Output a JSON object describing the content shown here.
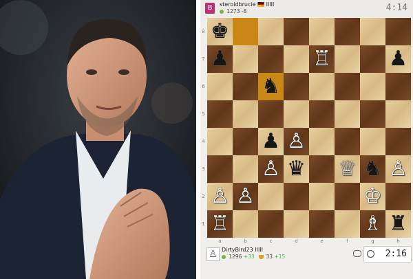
{
  "top_player": {
    "avatar_letter": "B",
    "name": "steroidbrucie",
    "flag": "🇩🇪",
    "badge": "IIIII",
    "rating": "1273",
    "rating_change": "-8",
    "clock": "4:14"
  },
  "bottom_player": {
    "name": "DirtyBird23",
    "badge": "IIIII",
    "rating": "1296",
    "rating_change": "+33",
    "trophy_count": "33",
    "trophy_change": "+15",
    "clock": "2:16"
  },
  "ranks": [
    "8",
    "7",
    "6",
    "5",
    "4",
    "3",
    "2",
    "1"
  ],
  "files": [
    "a",
    "b",
    "c",
    "d",
    "e",
    "f",
    "g",
    "h"
  ],
  "board": {
    "highlight_squares": [
      "b8",
      "c6"
    ],
    "pieces": [
      {
        "square": "a8",
        "color": "b",
        "glyph": "♚"
      },
      {
        "square": "a7",
        "color": "b",
        "glyph": "♟"
      },
      {
        "square": "h7",
        "color": "b",
        "glyph": "♟"
      },
      {
        "square": "e7",
        "color": "w",
        "glyph": "♖"
      },
      {
        "square": "c6",
        "color": "b",
        "glyph": "♞"
      },
      {
        "square": "c4",
        "color": "b",
        "glyph": "♟"
      },
      {
        "square": "d4",
        "color": "w",
        "glyph": "♙"
      },
      {
        "square": "c3",
        "color": "w",
        "glyph": "♙"
      },
      {
        "square": "d3",
        "color": "b",
        "glyph": "♛"
      },
      {
        "square": "f3",
        "color": "w",
        "glyph": "♕"
      },
      {
        "square": "g3",
        "color": "b",
        "glyph": "♞"
      },
      {
        "square": "h3",
        "color": "w",
        "glyph": "♙"
      },
      {
        "square": "a2",
        "color": "w",
        "glyph": "♙"
      },
      {
        "square": "b2",
        "color": "w",
        "glyph": "♙"
      },
      {
        "square": "g2",
        "color": "w",
        "glyph": "♔"
      },
      {
        "square": "a1",
        "color": "w",
        "glyph": "♖"
      },
      {
        "square": "g1",
        "color": "w",
        "glyph": "♗"
      },
      {
        "square": "h1",
        "color": "b",
        "glyph": "♜"
      }
    ]
  },
  "colors": {
    "highlight": "#c98716",
    "dark_square": "#6b3f1f",
    "light_square": "#e3c997",
    "accent": "#b5346f"
  }
}
